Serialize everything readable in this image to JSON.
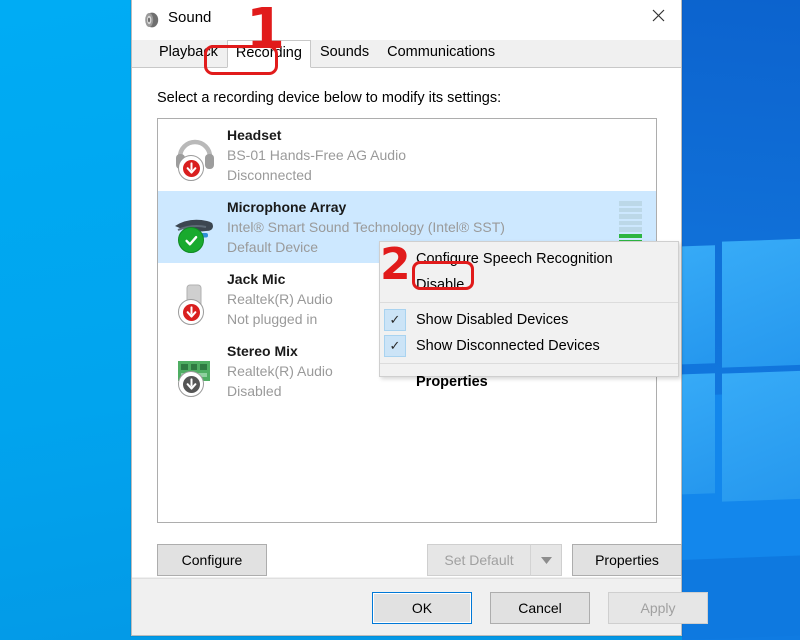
{
  "window": {
    "title": "Sound",
    "icon": "speaker-icon",
    "close_label": "✕"
  },
  "tabs": [
    {
      "label": "Playback",
      "selected": false
    },
    {
      "label": "Recording",
      "selected": true
    },
    {
      "label": "Sounds",
      "selected": false
    },
    {
      "label": "Communications",
      "selected": false
    }
  ],
  "panel": {
    "hint": "Select a recording device below to modify its settings:"
  },
  "devices": [
    {
      "name": "Headset",
      "description": "BS-01 Hands-Free AG Audio",
      "status": "Disconnected",
      "icon": "headset-icon",
      "badge": "red-down-arrow-badge",
      "selected": false,
      "meter": null
    },
    {
      "name": "Microphone Array",
      "description": "Intel® Smart Sound Technology (Intel® SST)",
      "status": "Default Device",
      "icon": "microphone-array-icon",
      "badge": "green-check-badge",
      "selected": true,
      "meter": {
        "segments": 8,
        "active": 3
      }
    },
    {
      "name": "Jack Mic",
      "description": "Realtek(R) Audio",
      "status": "Not plugged in",
      "icon": "audio-jack-icon",
      "badge": "red-down-arrow-badge",
      "selected": false,
      "meter": null
    },
    {
      "name": "Stereo Mix",
      "description": "Realtek(R) Audio",
      "status": "Disabled",
      "icon": "sound-card-icon",
      "badge": "gray-down-arrow-badge",
      "selected": false,
      "meter": null
    }
  ],
  "panel_buttons": {
    "configure": "Configure",
    "set_default": "Set Default",
    "set_default_arrow": "▼",
    "properties": "Properties"
  },
  "footer_buttons": {
    "ok": "OK",
    "cancel": "Cancel",
    "apply": "Apply"
  },
  "context_menu": {
    "items": [
      {
        "label": "Configure Speech Recognition",
        "checked": false,
        "bold": false
      },
      {
        "label": "Disable",
        "checked": false,
        "bold": false
      },
      {
        "label": "Show Disabled Devices",
        "checked": true,
        "bold": false
      },
      {
        "label": "Show Disconnected Devices",
        "checked": true,
        "bold": false
      },
      {
        "label": "Properties",
        "checked": false,
        "bold": true
      }
    ],
    "check_glyph": "✓"
  },
  "annotations": {
    "step_one": "1",
    "step_two": "2",
    "highlight_color": "#e11b1b",
    "boxed_tab": "Recording",
    "boxed_menu_item": "Disable"
  }
}
